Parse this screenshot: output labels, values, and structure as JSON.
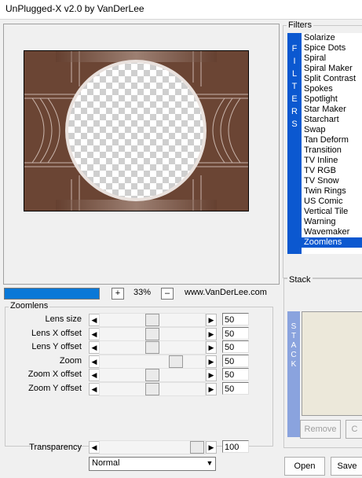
{
  "window": {
    "title": "UnPlugged-X v2.0 by VanDerLee"
  },
  "preview": {
    "zoom": "33%",
    "zoom_in": "+",
    "zoom_out": "–",
    "website": "www.VanDerLee.com",
    "progress_fraction": 1.0
  },
  "zoomlens": {
    "title": "Zoomlens",
    "rows": [
      {
        "label": "Lens size",
        "value": "50",
        "level": 0.5
      },
      {
        "label": "Lens X offset",
        "value": "50",
        "level": 0.5
      },
      {
        "label": "Lens Y offset",
        "value": "50",
        "level": 0.5
      },
      {
        "label": "Zoom",
        "value": "50",
        "level": 0.75
      },
      {
        "label": "Zoom X offset",
        "value": "50",
        "level": 0.5
      },
      {
        "label": "Zoom Y offset",
        "value": "50",
        "level": 0.5
      }
    ]
  },
  "transparency": {
    "label": "Transparency",
    "value": "100",
    "level": 1.0
  },
  "blend_mode": {
    "selected": "Normal"
  },
  "filters": {
    "title": "Filters",
    "tab_letters": [
      "F",
      "I",
      "L",
      "T",
      "E",
      "R",
      "S"
    ],
    "items": [
      "Solarize",
      "Spice Dots",
      "Spiral",
      "Spiral Maker",
      "Split Contrast",
      "Spokes",
      "Spotlight",
      "Star Maker",
      "Starchart",
      "Swap",
      "Tan Deform",
      "Transition",
      "TV Inline",
      "TV RGB",
      "TV Snow",
      "Twin Rings",
      "US Comic",
      "Vertical Tile",
      "Warning",
      "Wavemaker",
      "Zoomlens"
    ],
    "selected": "Zoomlens"
  },
  "stack": {
    "title": "Stack",
    "tab_letters": [
      "S",
      "T",
      "A",
      "C",
      "K"
    ],
    "remove_label": "Remove",
    "clear_label": "C"
  },
  "buttons": {
    "open": "Open",
    "save": "Save"
  },
  "arrows": {
    "left": "◀",
    "right": "▶",
    "down": "▼"
  }
}
